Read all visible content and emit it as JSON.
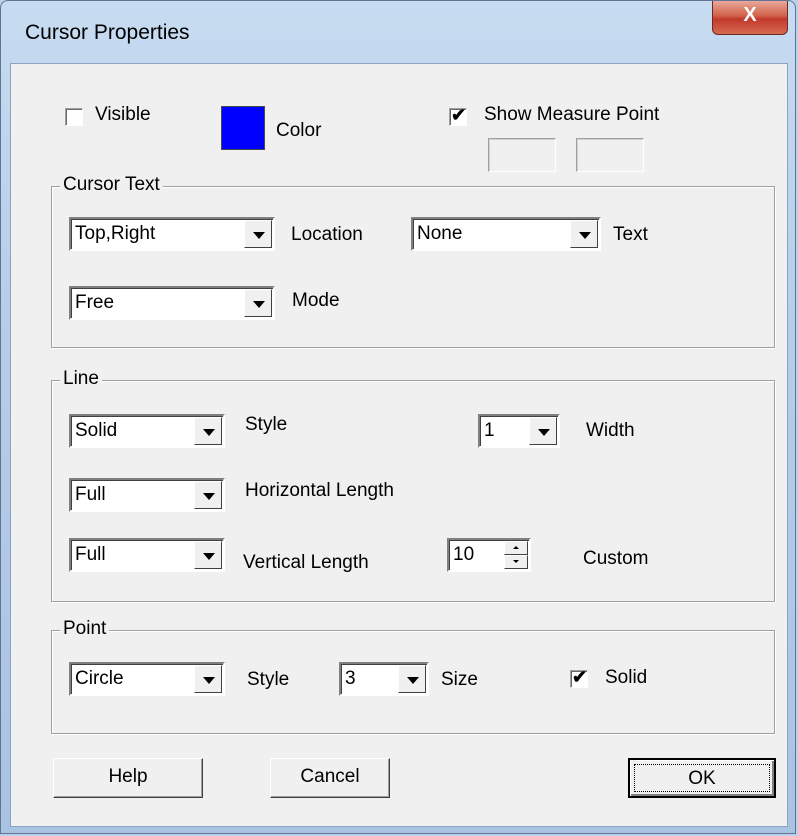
{
  "window": {
    "title": "Cursor Properties",
    "close_glyph": "X"
  },
  "general": {
    "visible": {
      "label": "Visible",
      "checked": false
    },
    "color": {
      "label": "Color",
      "value": "#0000ff"
    },
    "show_measure_point": {
      "label": "Show Measure Point",
      "checked": true,
      "check_glyph": "✔"
    }
  },
  "cursor_text": {
    "legend": "Cursor Text",
    "location": {
      "value": "Top,Right",
      "label": "Location"
    },
    "text": {
      "value": "None",
      "label": "Text"
    },
    "mode": {
      "value": "Free",
      "label": "Mode"
    }
  },
  "line": {
    "legend": "Line",
    "style": {
      "value": "Solid",
      "label": "Style"
    },
    "width": {
      "value": "1",
      "label": "Width"
    },
    "horizontal_length": {
      "value": "Full",
      "label": "Horizontal Length"
    },
    "vertical_length": {
      "value": "Full",
      "label": "Vertical Length"
    },
    "custom": {
      "value": "10",
      "label": "Custom"
    }
  },
  "point": {
    "legend": "Point",
    "style": {
      "value": "Circle",
      "label": "Style"
    },
    "size": {
      "value": "3",
      "label": "Size"
    },
    "solid": {
      "label": "Solid",
      "checked": true,
      "check_glyph": "✔"
    }
  },
  "buttons": {
    "help": "Help",
    "cancel": "Cancel",
    "ok": "OK"
  }
}
